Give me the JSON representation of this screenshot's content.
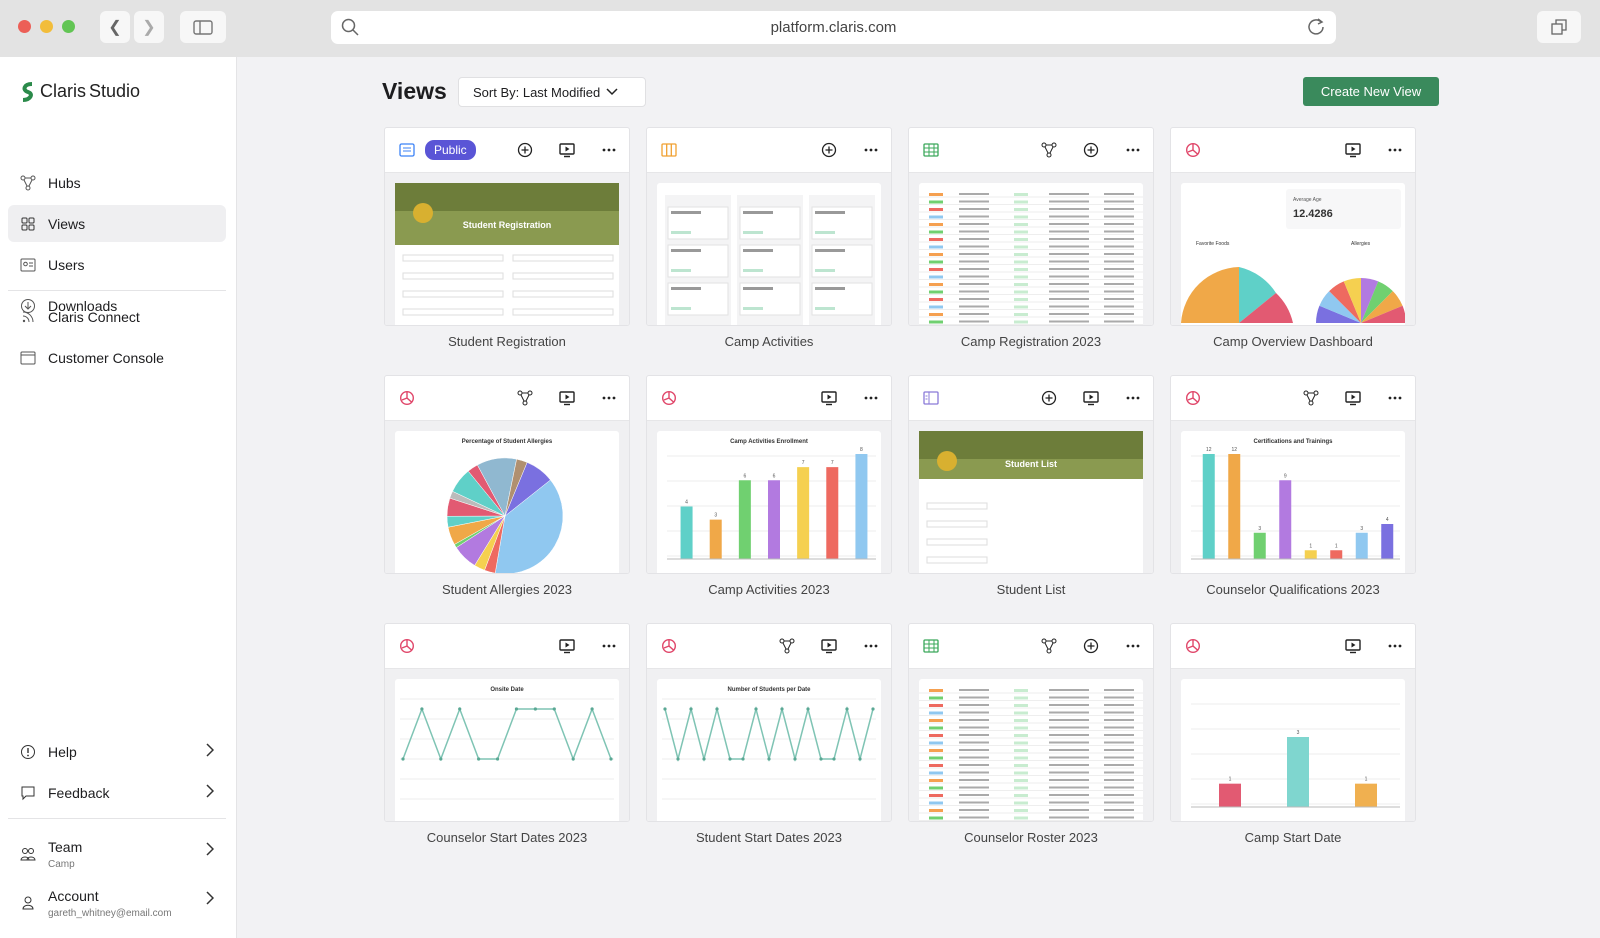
{
  "browser": {
    "url": "platform.claris.com"
  },
  "brand": {
    "name": "Claris",
    "product": "Studio",
    "logo_color": "#2b8a4a"
  },
  "sidebar": {
    "items": [
      {
        "label": "Hubs",
        "icon": "hubs-icon"
      },
      {
        "label": "Views",
        "icon": "views-icon",
        "active": true
      },
      {
        "label": "Users",
        "icon": "users-icon"
      },
      {
        "label": "Downloads",
        "icon": "download-icon"
      }
    ],
    "links": [
      {
        "label": "Claris Connect",
        "icon": "connect-icon"
      },
      {
        "label": "Customer Console",
        "icon": "console-icon"
      }
    ],
    "bottom": [
      {
        "label": "Help",
        "icon": "help-icon"
      },
      {
        "label": "Feedback",
        "icon": "feedback-icon"
      }
    ],
    "team": {
      "label": "Team",
      "sub": "Camp"
    },
    "account": {
      "label": "Account",
      "sub": "gareth_whitney@email.com"
    }
  },
  "header": {
    "title": "Views",
    "sort_label": "Sort By: Last Modified",
    "create_label": "Create New View",
    "accent": "#3a8a5c"
  },
  "badge_public": "Public",
  "cards": [
    {
      "title": "Student Registration",
      "type": "form",
      "badge": true,
      "actions": [
        "add",
        "present",
        "more"
      ],
      "thumb_title": "Student Registration"
    },
    {
      "title": "Camp Activities",
      "type": "kanban",
      "actions": [
        "add",
        "more"
      ]
    },
    {
      "title": "Camp Registration 2023",
      "type": "table",
      "actions": [
        "hub",
        "add",
        "more"
      ]
    },
    {
      "title": "Camp Overview Dashboard",
      "type": "dashboard",
      "actions": [
        "present",
        "more"
      ],
      "thumb_title": "Average Age",
      "thumb_value": "12.4286",
      "thumb_sub1": "Favorite Foods",
      "thumb_sub2": "Allergies"
    },
    {
      "title": "Student Allergies 2023",
      "type": "pie",
      "actions": [
        "hub",
        "present",
        "more"
      ],
      "thumb_title": "Percentage of Student Allergies",
      "values": [
        38,
        3,
        3,
        7,
        1,
        5,
        3,
        5,
        2,
        7,
        3,
        11,
        3,
        8
      ]
    },
    {
      "title": "Camp Activities 2023",
      "type": "bar",
      "actions": [
        "present",
        "more"
      ],
      "thumb_title": "Camp Activities Enrollment",
      "values": [
        4,
        3,
        6,
        6,
        7,
        7,
        8
      ]
    },
    {
      "title": "Student List",
      "type": "detail",
      "actions": [
        "add",
        "present",
        "more"
      ],
      "thumb_title": "Student List"
    },
    {
      "title": "Counselor Qualifications 2023",
      "type": "bar",
      "actions": [
        "hub",
        "present",
        "more"
      ],
      "thumb_title": "Certifications and Trainings",
      "values": [
        12,
        12,
        3,
        9,
        1,
        1,
        3,
        4
      ]
    },
    {
      "title": "Counselor Start Dates 2023",
      "type": "line",
      "actions": [
        "present",
        "more"
      ],
      "thumb_title": "Onsite Date",
      "values": [
        1,
        2,
        1,
        2,
        1,
        1,
        2,
        2,
        2,
        1,
        2,
        1
      ]
    },
    {
      "title": "Student Start Dates 2023",
      "type": "line",
      "actions": [
        "hub",
        "present",
        "more"
      ],
      "thumb_title": "Number of Students per Date",
      "values": [
        2,
        1,
        2,
        1,
        2,
        1,
        1,
        2,
        1,
        2,
        1,
        2,
        1,
        1,
        2,
        1,
        2
      ]
    },
    {
      "title": "Counselor Roster 2023",
      "type": "table",
      "actions": [
        "hub",
        "add",
        "more"
      ]
    },
    {
      "title": "Camp Start Date",
      "type": "bar3",
      "actions": [
        "present",
        "more"
      ],
      "values": [
        1,
        3,
        1
      ]
    }
  ],
  "colors": {
    "form": "#3b82f6",
    "kanban": "#f0a030",
    "table": "#3aa85a",
    "chart": "#e0476a",
    "detail": "#8a7ad8",
    "series": [
      "#5fd0c8",
      "#f0a848",
      "#70d070",
      "#b27ae0",
      "#f5d050",
      "#ee6a60",
      "#90c8f0",
      "#7a70e0"
    ]
  }
}
